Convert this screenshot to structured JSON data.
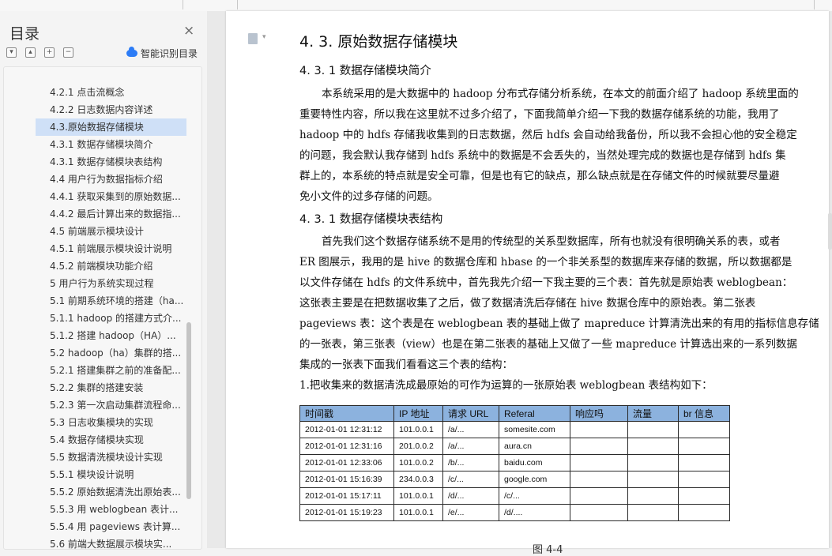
{
  "toc": {
    "title": "目录",
    "close_icon": "×",
    "tools": [
      "expand-all-icon",
      "collapse-up-icon",
      "add-level-icon",
      "remove-level-icon"
    ],
    "smart_label": "智能识别目录",
    "items": [
      {
        "label": "4.2.1  点击流概念"
      },
      {
        "label": "4.2.2  日志数据内容详述"
      },
      {
        "label": "4.3.原始数据存储模块",
        "active": true
      },
      {
        "label": "4.3.1 数据存储模块简介"
      },
      {
        "label": "4.3.1  数据存储模块表结构"
      },
      {
        "label": "4.4  用户行为数据指标介绍"
      },
      {
        "label": "4.4.1  获取采集到的原始数据..."
      },
      {
        "label": "4.4.2  最后计算出来的数据指..."
      },
      {
        "label": "4.5  前端展示模块设计"
      },
      {
        "label": "4.5.1  前端展示模块设计说明"
      },
      {
        "label": "4.5.2  前端模块功能介绍"
      },
      {
        "label": "5  用户行为系统实现过程"
      },
      {
        "label": "5.1 前期系统环境的搭建（ha..."
      },
      {
        "label": "5.1.1 hadoop 的搭建方式介..."
      },
      {
        "label": "5.1.2  搭建 hadoop（HA）..."
      },
      {
        "label": "5.2 hadoop（ha）集群的搭..."
      },
      {
        "label": "5.2.1  搭建集群之前的准备配..."
      },
      {
        "label": "5.2.2  集群的搭建安装"
      },
      {
        "label": "5.2.3  第一次启动集群流程命..."
      },
      {
        "label": "5.3  日志收集模块的实现"
      },
      {
        "label": "5.4  数据存储模块实现"
      },
      {
        "label": "5.5  数据清洗模块设计实现"
      },
      {
        "label": "5.5.1  模块设计说明"
      },
      {
        "label": "5.5.2 原始数据清洗出原始表..."
      },
      {
        "label": "5.5.3  用 weblogbean 表计..."
      },
      {
        "label": "5.5.4  用 pageviews 表计算..."
      },
      {
        "label": "5.6  前端大数据展示模块实..."
      },
      {
        "label": "5.6.1  前端模块功能以及实现..."
      }
    ]
  },
  "doc": {
    "heading": "4. 3. 原始数据存储模块",
    "sub1": "4. 3. 1 数据存储模块简介",
    "para1": [
      "本系统采用的是大数据中的 hadoop 分布式存储分析系统，在本文的前面介绍了 hadoop 系统里面的",
      "重要特性内容，所以我在这里就不过多介绍了，下面我简单介绍一下我的数据存储系统的功能，我用了",
      "hadoop 中的 hdfs 存储我收集到的日志数据，然后 hdfs 会自动给我备份，所以我不会担心他的安全稳定",
      "的问题，我会默认我存储到 hdfs 系统中的数据是不会丢失的，当然处理完成的数据也是存储到 hdfs 集",
      "群上的，本系统的特点就是安全可靠，但是也有它的缺点，那么缺点就是在存储文件的时候就要尽量避",
      "免小文件的过多存储的问题。"
    ],
    "sub2": "4. 3. 1  数据存储模块表结构",
    "para2": [
      "首先我们这个数据存储系统不是用的传统型的关系型数据库，所有也就没有很明确关系的表，或者",
      "ER 图展示，我用的是 hive 的数据仓库和 hbase 的一个非关系型的数据库来存储的数据，所以数据都是",
      "以文件存储在 hdfs 的文件系统中，首先我先介绍一下我主要的三个表：首先就是原始表 weblogbean：",
      "这张表主要是在把数据收集了之后，做了数据清洗后存储在 hive 数据仓库中的原始表。第二张表",
      "pageviews 表：这个表是在 weblogbean 表的基础上做了 mapreduce 计算清洗出来的有用的指标信息存储",
      "的一张表，第三张表（view）也是在第二张表的基础上又做了一些 mapreduce 计算选出来的一系列数据",
      "集成的一张表下面我们看看这三个表的结构："
    ],
    "intro_line": "1.把收集来的数据清洗成最原始的可作为运算的一张原始表 weblogbean 表结构如下：",
    "caption": "图 4-4"
  },
  "table": {
    "headers": [
      "时间戳",
      "IP 地址",
      "请求 URL",
      "Referal",
      "响应吗",
      "流量",
      "br 信息"
    ],
    "rows": [
      [
        "2012-01-01 12:31:12",
        "101.0.0.1",
        "/a/...",
        "somesite.com",
        "",
        "",
        ""
      ],
      [
        "2012-01-01 12:31:16",
        "201.0.0.2",
        "/a/...",
        "aura.cn",
        "",
        "",
        ""
      ],
      [
        "2012-01-01 12:33:06",
        "101.0.0.2",
        "/b/...",
        "baidu.com",
        "",
        "",
        ""
      ],
      [
        "2012-01-01 15:16:39",
        "234.0.0.3",
        "/c/...",
        "google.com",
        "",
        "",
        ""
      ],
      [
        "2012-01-01 15:17:11",
        "101.0.0.1",
        "/d/...",
        "/c/...",
        "",
        "",
        ""
      ],
      [
        "2012-01-01 15:19:23",
        "101.0.0.1",
        "/e/...",
        "/d/....",
        "",
        "",
        ""
      ]
    ]
  }
}
